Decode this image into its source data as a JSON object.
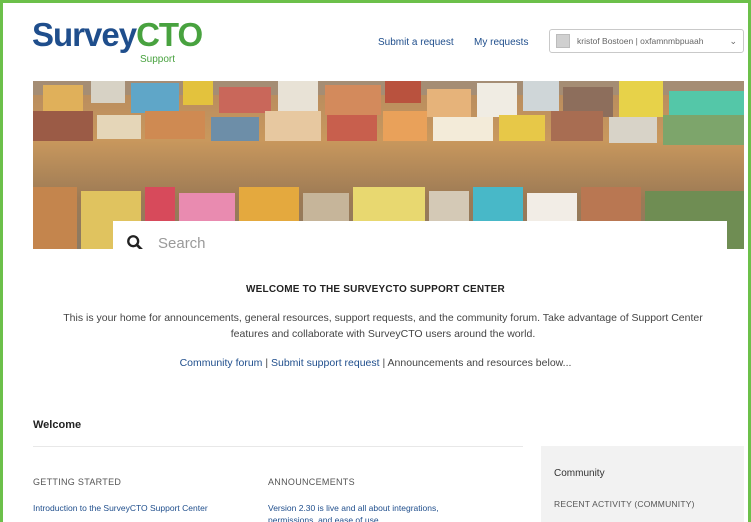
{
  "header": {
    "logo_part1": "Survey",
    "logo_part2": "CTO",
    "logo_sub": "Support",
    "submit_request": "Submit a request",
    "my_requests": "My requests",
    "user_name": "kristof Bostoen | oxfamnmbpuaah"
  },
  "search": {
    "placeholder": "Search"
  },
  "welcome": {
    "title": "WELCOME TO THE SURVEYCTO SUPPORT CENTER",
    "body": "This is your home for announcements, general resources, support requests, and the community forum. Take advantage of Support Center features and collaborate with SurveyCTO users around the world.",
    "link_forum": "Community forum",
    "sep": " | ",
    "link_submit": "Submit support request",
    "tail": " | Announcements and resources below..."
  },
  "section": {
    "title": "Welcome",
    "col1_head": "GETTING STARTED",
    "col1_link": "Introduction to the SurveyCTO Support Center",
    "col2_head": "ANNOUNCEMENTS",
    "col2_link": "Version 2.30 is live and all about integrations, permissions, and ease of use"
  },
  "sidebar": {
    "title": "Community",
    "subtitle": "RECENT ACTIVITY (COMMUNITY)"
  },
  "colors": {
    "brand_blue": "#1f4e8c",
    "brand_green": "#48a23f",
    "frame_green": "#6cc04a"
  }
}
